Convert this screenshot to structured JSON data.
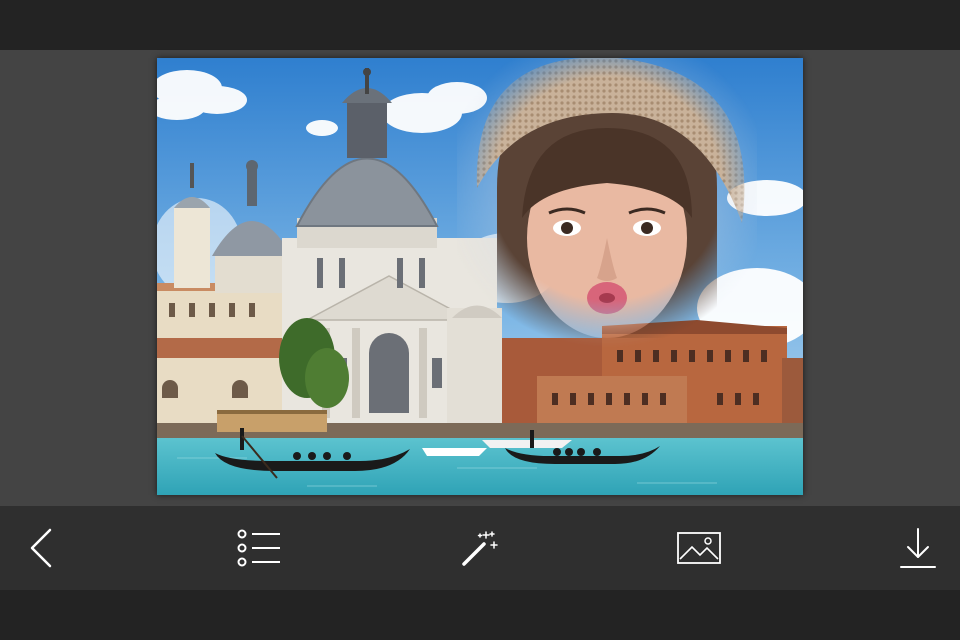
{
  "colors": {
    "background": "#232323",
    "canvas": "#444444",
    "toolbar": "#2f2f2f",
    "icon": "#ffffff",
    "sky": "#3d8fd8",
    "water": "#43b6c4"
  },
  "photo": {
    "scene": "venice-grand-canal",
    "overlay": "face-in-knit-hat"
  },
  "toolbar": {
    "buttons": [
      {
        "icon": "chevron-left-icon",
        "action": "back"
      },
      {
        "icon": "list-icon",
        "action": "frames"
      },
      {
        "icon": "magic-wand-icon",
        "action": "effects"
      },
      {
        "icon": "image-icon",
        "action": "gallery"
      },
      {
        "icon": "download-icon",
        "action": "save"
      }
    ]
  }
}
